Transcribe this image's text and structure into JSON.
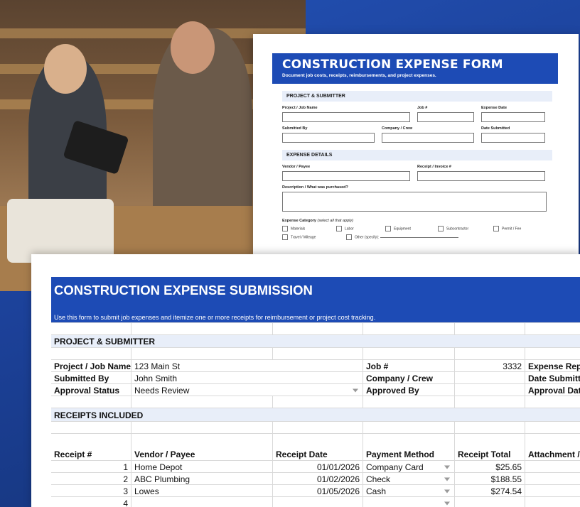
{
  "paper_form": {
    "title": "CONSTRUCTION EXPENSE FORM",
    "subtitle": "Document job costs, receipts, reimbursements, and project expenses.",
    "section1": "PROJECT & SUBMITTER",
    "project_job_name": "Project / Job Name",
    "job_no": "Job #",
    "expense_date": "Expense Date",
    "submitted_by": "Submitted By",
    "company_crew": "Company / Crew",
    "date_submitted": "Date Submitted",
    "section2": "EXPENSE DETAILS",
    "vendor_payee": "Vendor / Payee",
    "receipt_invoice": "Receipt / Invoice #",
    "description": "Description / What was purchased?",
    "category_label": "Expense Category",
    "category_hint": "(select all that apply)",
    "categories": [
      "Materials",
      "Labor",
      "Equipment",
      "Subcontractor",
      "Permit / Fee",
      "Travel / Mileage",
      "Other (specify):"
    ]
  },
  "sheet": {
    "title": "CONSTRUCTION EXPENSE SUBMISSION",
    "subtitle": "Use this form to submit job expenses and itemize one or more receipts for reimbursement or project cost tracking.",
    "section_project": "PROJECT & SUBMITTER",
    "project_label": "Project / Job Name",
    "project_value": "123 Main St",
    "job_label": "Job #",
    "job_value": "3332",
    "expense_report_label": "Expense Repo",
    "submitted_label": "Submitted By",
    "submitted_value": "John Smith",
    "company_label": "Company / Crew",
    "date_submitted_label": "Date Submitte",
    "approval_label": "Approval Status",
    "approval_value": "Needs Review",
    "approved_by_label": "Approved By",
    "approval_date_label": "Approval Date",
    "section_receipts": "RECEIPTS INCLUDED",
    "columns": {
      "receipt_no": "Receipt #",
      "vendor": "Vendor / Payee",
      "date": "Receipt Date",
      "payment": "Payment Method",
      "total": "Receipt Total",
      "attachment": "Attachment /"
    },
    "rows": [
      {
        "no": "1",
        "vendor": "Home Depot",
        "date": "01/01/2026",
        "payment": "Company Card",
        "total": "$25.65"
      },
      {
        "no": "2",
        "vendor": "ABC Plumbing",
        "date": "01/02/2026",
        "payment": "Check",
        "total": "$188.55"
      },
      {
        "no": "3",
        "vendor": "Lowes",
        "date": "01/05/2026",
        "payment": "Cash",
        "total": "$274.54"
      },
      {
        "no": "4",
        "vendor": "",
        "date": "",
        "payment": "",
        "total": ""
      }
    ]
  }
}
